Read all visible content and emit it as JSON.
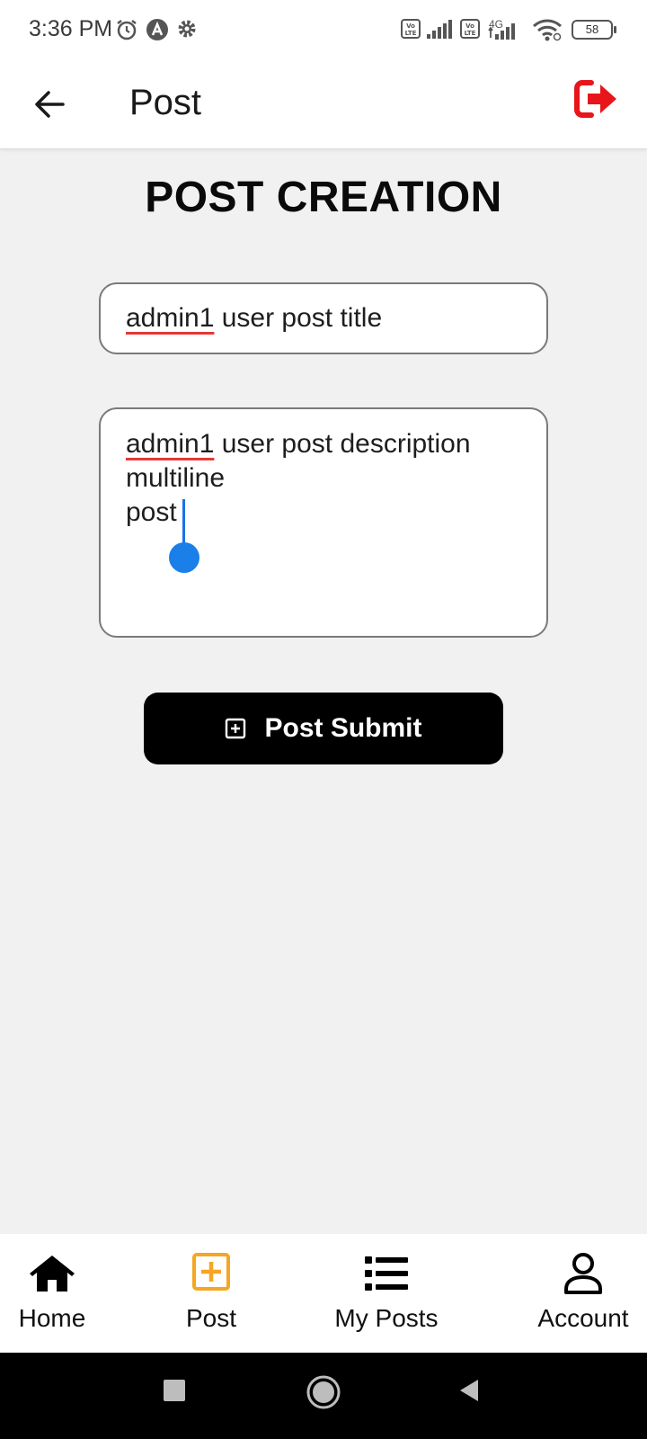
{
  "status_bar": {
    "time": "3:36 PM",
    "battery": "58",
    "network": "4G",
    "icons": [
      "alarm-icon",
      "app-icon",
      "settings-icon",
      "volte-icon",
      "signal-icon",
      "volte-icon",
      "signal-icon",
      "wifi-icon",
      "battery-icon"
    ]
  },
  "app_bar": {
    "title": "Post",
    "back_icon": "arrow-left-icon",
    "logout_icon": "logout-icon",
    "logout_color": "#e8151b"
  },
  "main": {
    "heading": "POST CREATION",
    "title_input": {
      "value_flagged": "admin1",
      "value_rest": " user post title"
    },
    "description_input": {
      "value_flagged": "admin1",
      "value_rest": " user post description\nmultiline\npost"
    },
    "submit_label": "Post Submit",
    "submit_icon": "plus-square-icon"
  },
  "bottom_nav": {
    "active_color": "#f5a623",
    "items": [
      {
        "label": "Home",
        "icon": "home-icon",
        "active": false
      },
      {
        "label": "Post",
        "icon": "plus-square-icon",
        "active": true
      },
      {
        "label": "My Posts",
        "icon": "list-icon",
        "active": false
      },
      {
        "label": "Account",
        "icon": "user-icon",
        "active": false
      }
    ]
  },
  "system_nav": {
    "icons": [
      "recents-icon",
      "home-circle-icon",
      "back-triangle-icon"
    ]
  }
}
